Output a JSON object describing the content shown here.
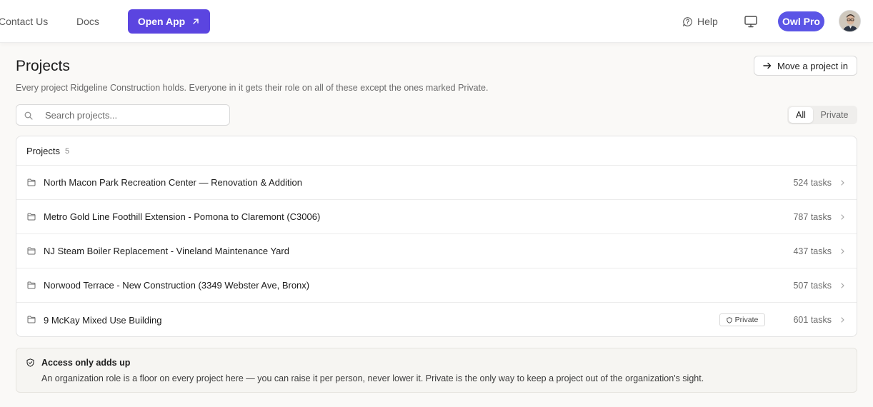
{
  "nav": {
    "contact": "Contact Us",
    "docs": "Docs",
    "open_app": "Open App",
    "help": "Help",
    "plan_badge": "Owl Pro"
  },
  "header": {
    "title": "Projects",
    "subtitle": "Every project Ridgeline Construction holds. Everyone in it gets their role on all of these except the ones marked Private.",
    "move_button": "Move a project in"
  },
  "search": {
    "placeholder": "Search projects..."
  },
  "filter": {
    "options": [
      "All",
      "Private"
    ],
    "selected": "All"
  },
  "list": {
    "heading": "Projects",
    "count": "5",
    "private_label": "Private",
    "rows": [
      {
        "name": "North Macon Park Recreation Center — Renovation & Addition",
        "tasks": "524 tasks",
        "private": false
      },
      {
        "name": "Metro Gold Line Foothill Extension - Pomona to Claremont (C3006)",
        "tasks": "787 tasks",
        "private": false
      },
      {
        "name": "NJ Steam Boiler Replacement - Vineland Maintenance Yard",
        "tasks": "437 tasks",
        "private": false
      },
      {
        "name": "Norwood Terrace - New Construction (3349 Webster Ave, Bronx)",
        "tasks": "507 tasks",
        "private": false
      },
      {
        "name": "9 McKay Mixed Use Building",
        "tasks": "601 tasks",
        "private": true
      }
    ]
  },
  "info": {
    "title": "Access only adds up",
    "body": "An organization role is a floor on every project here — you can raise it per person, never lower it. Private is the only way to keep a project out of the organization's sight."
  },
  "colors": {
    "accent": "#5b45e0",
    "plan_badge": "#5b55e6"
  }
}
